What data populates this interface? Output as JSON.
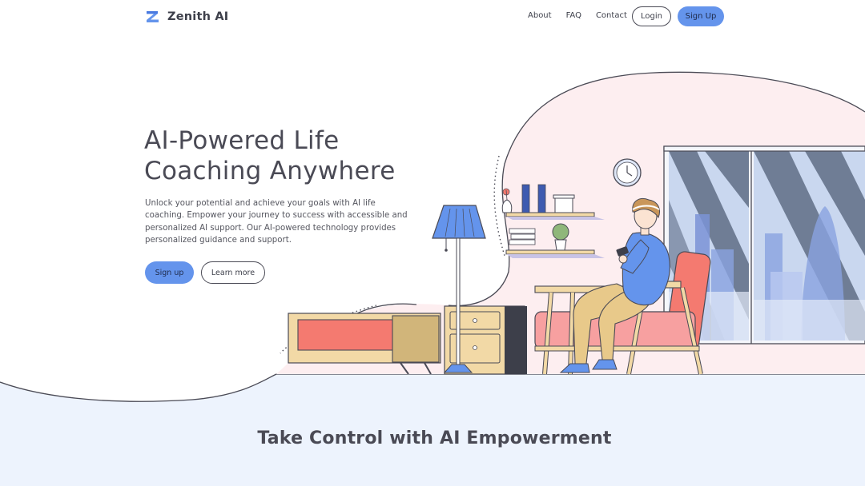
{
  "brand": {
    "name": "Zenith AI",
    "logo_icon": "zenith-z-logo",
    "accent": "#6494ec"
  },
  "nav": {
    "links": [
      "About",
      "FAQ",
      "Contact"
    ],
    "login_label": "Login",
    "signup_label": "Sign Up"
  },
  "hero": {
    "title_line1": "AI-Powered Life",
    "title_line2": "Coaching Anywhere",
    "description": "Unlock your potential and achieve your goals with AI life coaching. Empower your journey to success with accessible and personalized AI support. Our AI-powered technology provides personalized guidance and support.",
    "signup_label": "Sign up",
    "learn_more_label": "Learn more",
    "illustration": "person-on-armchair-using-phone-illustration"
  },
  "features": {
    "heading": "Take Control with AI Empowerment"
  },
  "colors": {
    "primary": "#6494ec",
    "text": "#4a4a55",
    "blob_pink": "#fdeef0",
    "bottom_band": "#edf3fd",
    "chair": "#f47a70",
    "wood": "#f2d9a6"
  }
}
